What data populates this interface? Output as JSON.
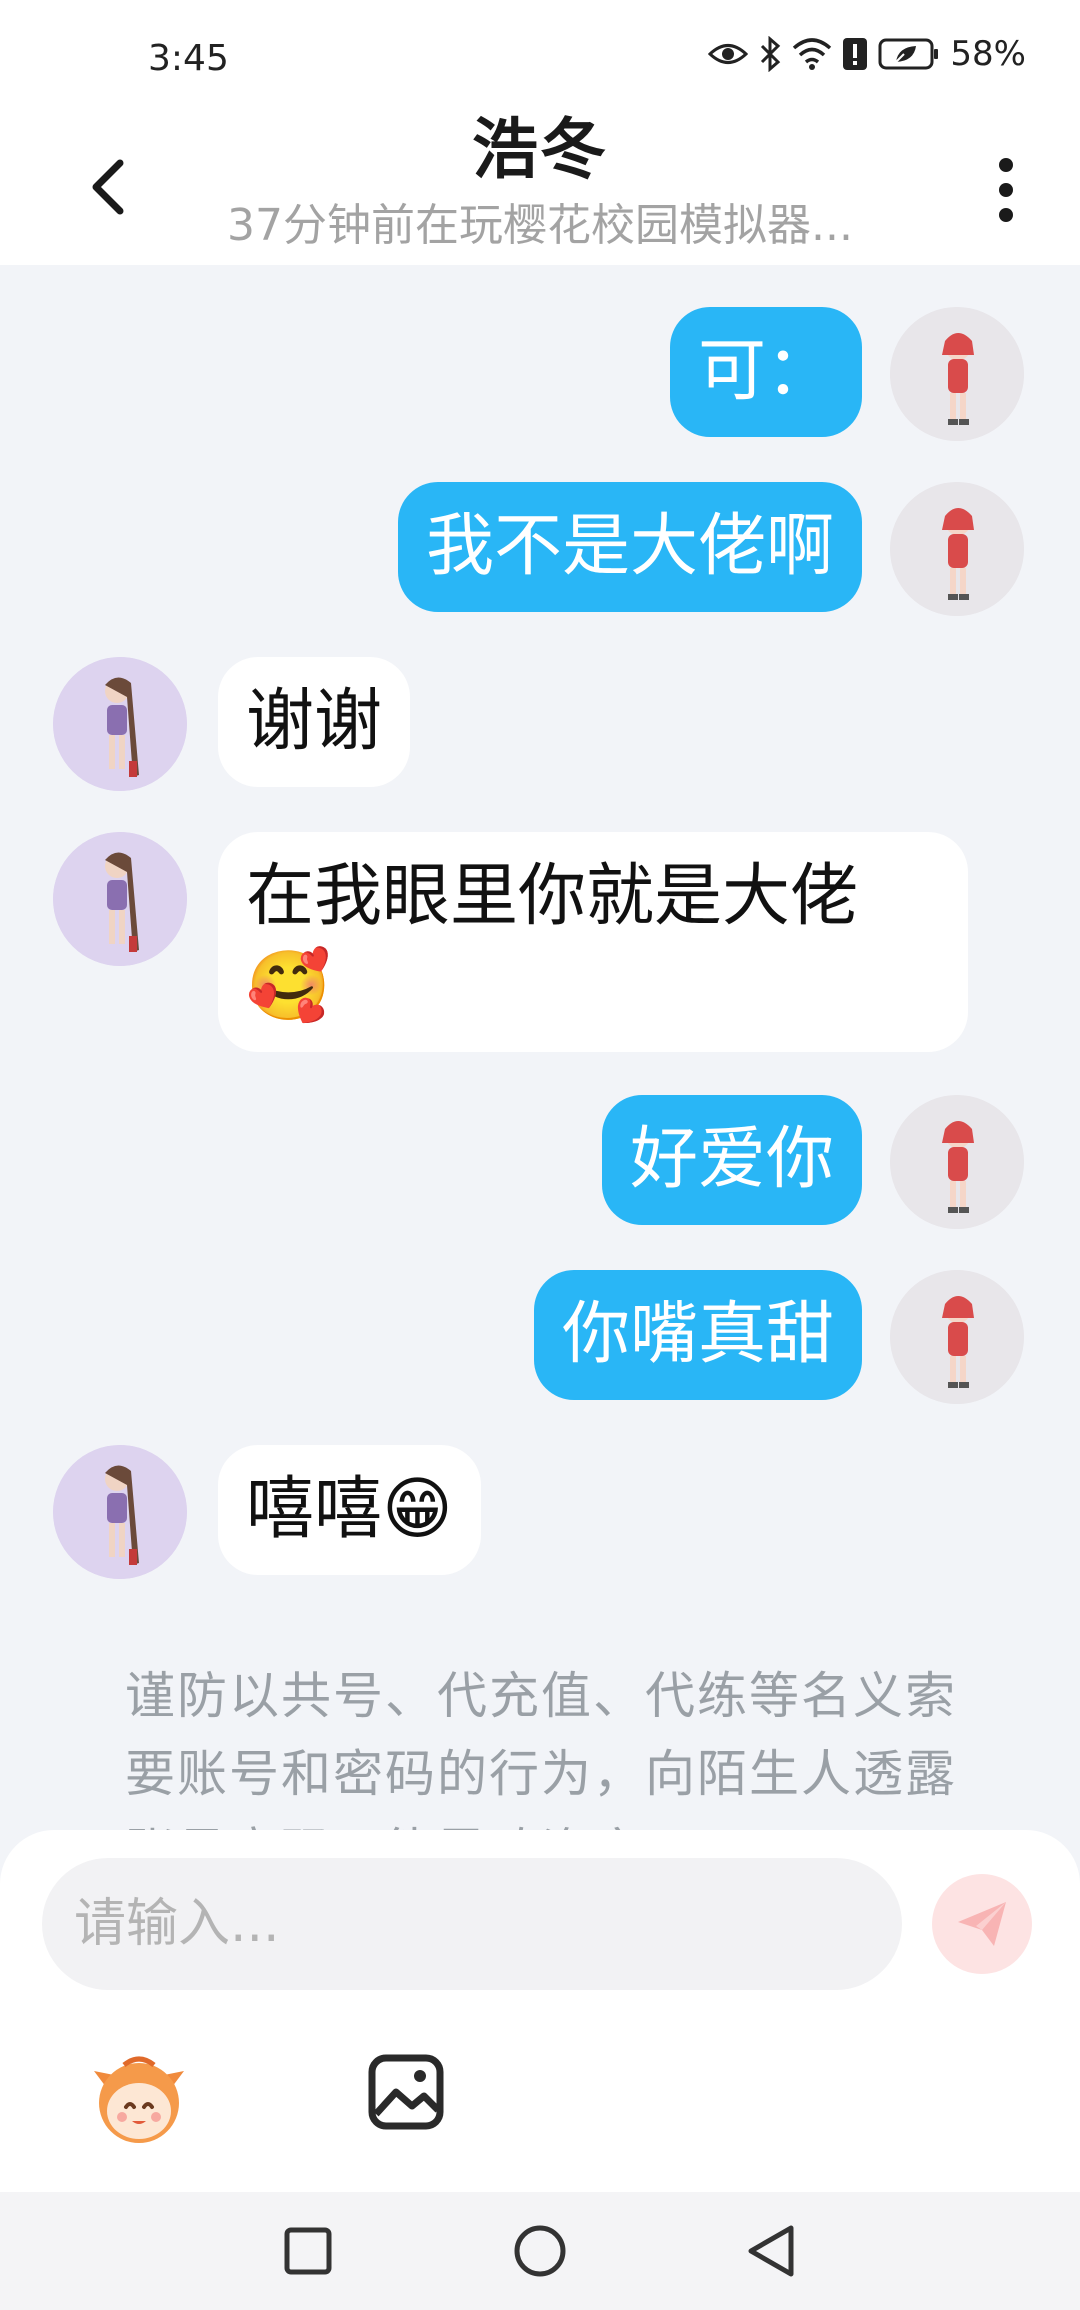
{
  "status_bar": {
    "time": "3:45",
    "battery": "58%"
  },
  "header": {
    "title": "浩冬",
    "subtitle": "37分钟前在玩樱花校园模拟器..."
  },
  "messages": [
    {
      "from": "me",
      "text": "可："
    },
    {
      "from": "me",
      "text": "我不是大佬啊"
    },
    {
      "from": "other",
      "text": "谢谢"
    },
    {
      "from": "other",
      "text": "在我眼里你就是大佬🥰"
    },
    {
      "from": "me",
      "text": "好爱你"
    },
    {
      "from": "me",
      "text": "你嘴真甜"
    },
    {
      "from": "other",
      "text": "嘻嘻😁"
    }
  ],
  "notice": "谨防以共号、代充值、代练等名义索要账号和密码的行为，向陌生人透露账号密码可能导致资产",
  "input": {
    "placeholder": "请输入..."
  },
  "colors": {
    "my_bubble": "#29b6f6",
    "other_bubble": "#ffffff",
    "background": "#f2f4f8"
  }
}
